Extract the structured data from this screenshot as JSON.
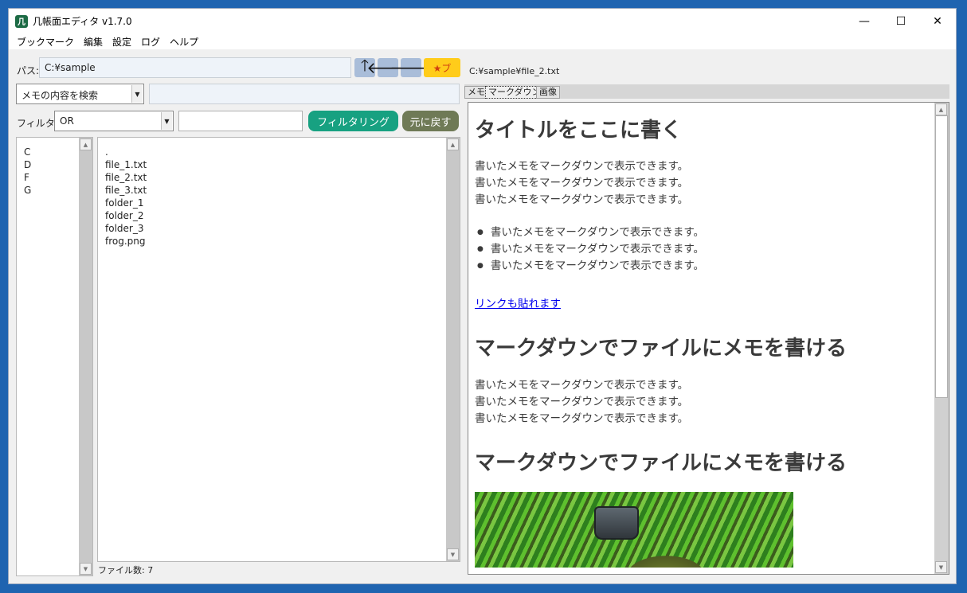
{
  "window": {
    "title": "几帳面エディタ v1.7.0",
    "icon_glyph": "几",
    "controls": {
      "minimize": "—",
      "maximize": "☐",
      "close": "✕"
    }
  },
  "menu": [
    "ブックマーク",
    "編集",
    "設定",
    "ログ",
    "ヘルプ"
  ],
  "path_bar": {
    "label": "パス:",
    "value": "C:¥sample",
    "up": "🡑",
    "back": "🡐",
    "forward": "🡒",
    "bookmark": "★ブ"
  },
  "search": {
    "mode": "メモの内容を検索",
    "value": ""
  },
  "filter": {
    "label": "フィルター:",
    "mode": "OR",
    "value": "",
    "apply_label": "フィルタリング",
    "reset_label": "元に戻す"
  },
  "drives": [
    "C",
    "D",
    "F",
    "G"
  ],
  "files": [
    ".",
    "file_1.txt",
    "file_2.txt",
    "file_3.txt",
    "folder_1",
    "folder_2",
    "folder_3",
    "frog.png"
  ],
  "status": "ファイル数: 7",
  "viewer": {
    "path": "C:¥sample¥file_2.txt",
    "tabs": [
      "メモ",
      "マークダウン",
      "画像"
    ],
    "active_tab": 1,
    "markdown": {
      "h1_a": "タイトルをここに書く",
      "para1": [
        "書いたメモをマークダウンで表示できます。",
        "書いたメモをマークダウンで表示できます。",
        "書いたメモをマークダウンで表示できます。"
      ],
      "bullets": [
        "書いたメモをマークダウンで表示できます。",
        "書いたメモをマークダウンで表示できます。",
        "書いたメモをマークダウンで表示できます。"
      ],
      "link": "リンクも貼れます",
      "h1_b": "マークダウンでファイルにメモを書ける",
      "para2": [
        "書いたメモをマークダウンで表示できます。",
        "書いたメモをマークダウンで表示できます。",
        "書いたメモをマークダウンで表示できます。"
      ],
      "h1_c": "マークダウンでファイルにメモを書ける"
    }
  },
  "colors": {
    "filter_button": "#17a181",
    "reset_button": "#6f7a56",
    "bookmark_button": "#ffcc1a",
    "nav_button": "#a9bdd9"
  }
}
